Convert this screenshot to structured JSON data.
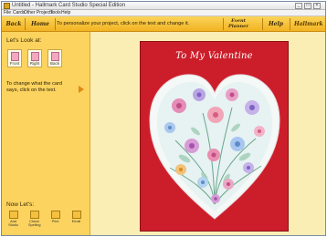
{
  "window": {
    "title": "Untitled - Hallmark Card Studio Special Edition",
    "controls": {
      "minimize": "_",
      "maximize": "□",
      "close": "×"
    }
  },
  "menu": [
    "File",
    "Cards",
    "Other Projects",
    "Tools",
    "Help"
  ],
  "toolbar": {
    "back": "Back",
    "home": "Home",
    "help_text": "To personalize your project, click on the text and change it.",
    "event_planner": "Event Planner",
    "help": "Help",
    "logo": "Hallmark"
  },
  "left_panel": {
    "look_heading": "Let's Look at:",
    "views": [
      "Front",
      "Right",
      "Back"
    ],
    "hint": "To change what the card says, click on the text.",
    "now_heading": "Now Let's:",
    "actions": [
      "Add Studio",
      "Check Spelling",
      "Print",
      "Email"
    ]
  },
  "card": {
    "title": "To My Valentine",
    "background_color": "#cc1e2a"
  },
  "colors": {
    "toolbar": "#f2b322",
    "panel": "#fbd35e",
    "content_bg": "#fbeeb5"
  }
}
